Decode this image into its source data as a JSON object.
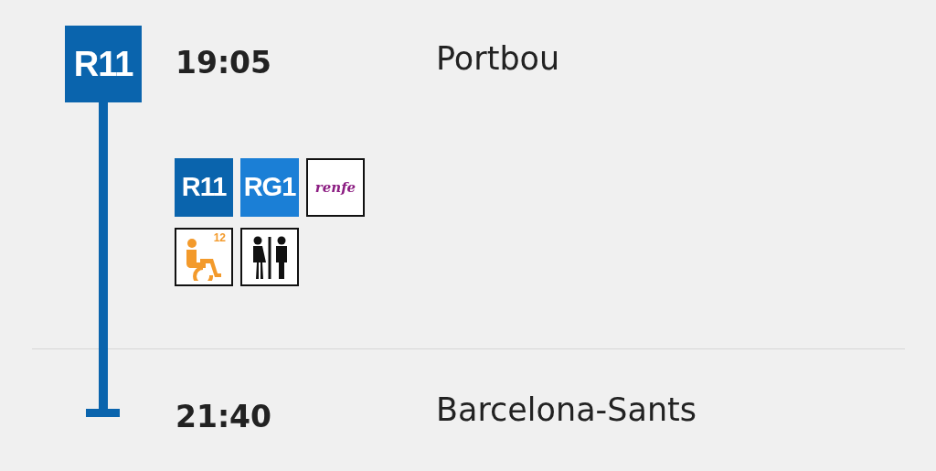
{
  "line": {
    "label": "R11",
    "color": "#0a64ad"
  },
  "departure": {
    "time": "19:05",
    "station": "Portbou"
  },
  "services": [
    {
      "kind": "line",
      "label": "R11",
      "color": "#0a64ad"
    },
    {
      "kind": "line",
      "label": "RG1",
      "color": "#1b7fd6"
    },
    {
      "kind": "operator",
      "label": "renfe",
      "color": "#8c1d82"
    }
  ],
  "amenities": [
    {
      "kind": "accessible",
      "label": "12"
    },
    {
      "kind": "toilets"
    }
  ],
  "arrival": {
    "time": "21:40",
    "station": "Barcelona-Sants"
  }
}
